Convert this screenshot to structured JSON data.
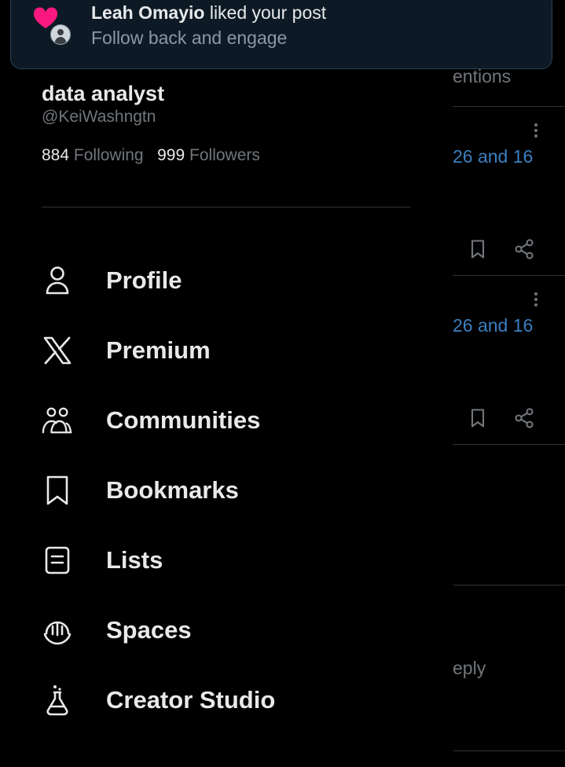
{
  "notification": {
    "actor": "Leah Omayio",
    "action": " liked your post",
    "subtitle": "Follow back and engage",
    "heart_color": "#f91880"
  },
  "profile": {
    "display_name": "data analyst",
    "handle": "@KeiWashngtn",
    "following_count": "884",
    "following_label": "Following",
    "followers_count": "999",
    "followers_label": "Followers"
  },
  "menu": [
    {
      "label": "Profile",
      "icon": "person-icon"
    },
    {
      "label": "Premium",
      "icon": "x-logo-icon"
    },
    {
      "label": "Communities",
      "icon": "communities-icon"
    },
    {
      "label": "Bookmarks",
      "icon": "bookmark-icon"
    },
    {
      "label": "Lists",
      "icon": "list-icon"
    },
    {
      "label": "Spaces",
      "icon": "spaces-icon"
    },
    {
      "label": "Creator Studio",
      "icon": "flask-icon"
    }
  ],
  "feed": {
    "partial_tab": "entions",
    "post1_text": "26 and 16",
    "post2_text": "26 and 16",
    "reply_text": "eply",
    "link_color": "#1d9bf0"
  }
}
